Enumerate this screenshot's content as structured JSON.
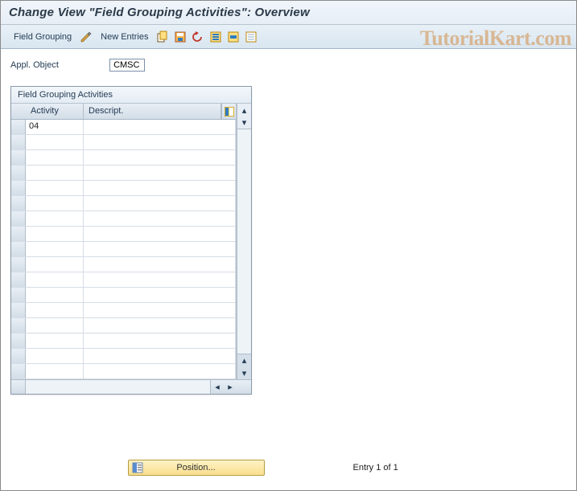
{
  "title": "Change View \"Field Grouping Activities\": Overview",
  "toolbar": {
    "fieldGrouping": "Field Grouping",
    "newEntries": "New Entries"
  },
  "applObject": {
    "label": "Appl. Object",
    "value": "CMSC"
  },
  "table": {
    "title": "Field Grouping Activities",
    "headers": {
      "activity": "Activity",
      "descript": "Descript."
    },
    "rows": [
      {
        "activity": "04",
        "descript": ""
      },
      {
        "activity": "",
        "descript": ""
      },
      {
        "activity": "",
        "descript": ""
      },
      {
        "activity": "",
        "descript": ""
      },
      {
        "activity": "",
        "descript": ""
      },
      {
        "activity": "",
        "descript": ""
      },
      {
        "activity": "",
        "descript": ""
      },
      {
        "activity": "",
        "descript": ""
      },
      {
        "activity": "",
        "descript": ""
      },
      {
        "activity": "",
        "descript": ""
      },
      {
        "activity": "",
        "descript": ""
      },
      {
        "activity": "",
        "descript": ""
      },
      {
        "activity": "",
        "descript": ""
      },
      {
        "activity": "",
        "descript": ""
      },
      {
        "activity": "",
        "descript": ""
      },
      {
        "activity": "",
        "descript": ""
      },
      {
        "activity": "",
        "descript": ""
      }
    ]
  },
  "footer": {
    "positionLabel": "Position...",
    "entryText": "Entry 1 of 1"
  },
  "watermark": "TutorialKart.com",
  "icons": {
    "pencil": "pencil-icon",
    "copy": "copy-icon",
    "save": "save-icon",
    "undo": "undo-icon",
    "selectAll": "select-all-icon",
    "selectBlock": "select-block-icon",
    "deselect": "deselect-icon",
    "configure": "configure-columns-icon",
    "position": "position-icon"
  }
}
